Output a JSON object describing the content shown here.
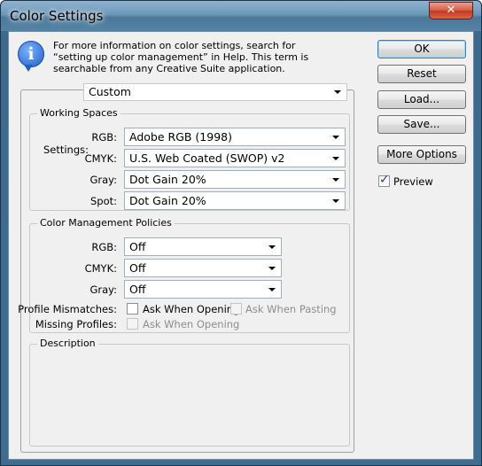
{
  "window": {
    "title": "Color Settings",
    "close_glyph": "✕"
  },
  "info": {
    "icon_glyph": "i",
    "text": "For more information on color settings, search for “setting up color management” in Help. This term is searchable from any Creative Suite application."
  },
  "settings": {
    "label": "Settings:",
    "value": "Custom"
  },
  "working_spaces": {
    "title": "Working Spaces",
    "rows": [
      {
        "label": "RGB:",
        "value": "Adobe RGB (1998)"
      },
      {
        "label": "CMYK:",
        "value": "U.S. Web Coated (SWOP) v2"
      },
      {
        "label": "Gray:",
        "value": "Dot Gain 20%"
      },
      {
        "label": "Spot:",
        "value": "Dot Gain 20%"
      }
    ]
  },
  "policies": {
    "title": "Color Management Policies",
    "rows": [
      {
        "label": "RGB:",
        "value": "Off"
      },
      {
        "label": "CMYK:",
        "value": "Off"
      },
      {
        "label": "Gray:",
        "value": "Off"
      }
    ],
    "profile_mismatches_label": "Profile Mismatches:",
    "ask_when_opening": "Ask When Opening",
    "ask_when_pasting": "Ask When Pasting",
    "missing_profiles_label": "Missing Profiles:",
    "missing_ask_when_opening": "Ask When Opening"
  },
  "description": {
    "title": "Description"
  },
  "buttons": {
    "ok": "OK",
    "reset": "Reset",
    "load": "Load...",
    "save": "Save...",
    "more_options": "More Options"
  },
  "preview": {
    "label": "Preview",
    "checked": true
  },
  "colors": {
    "titlebar": "#6c97b9",
    "close_button": "#c03a1e",
    "dialog_bg": "#f0f0f0",
    "default_button_border": "#3c7fb1"
  }
}
